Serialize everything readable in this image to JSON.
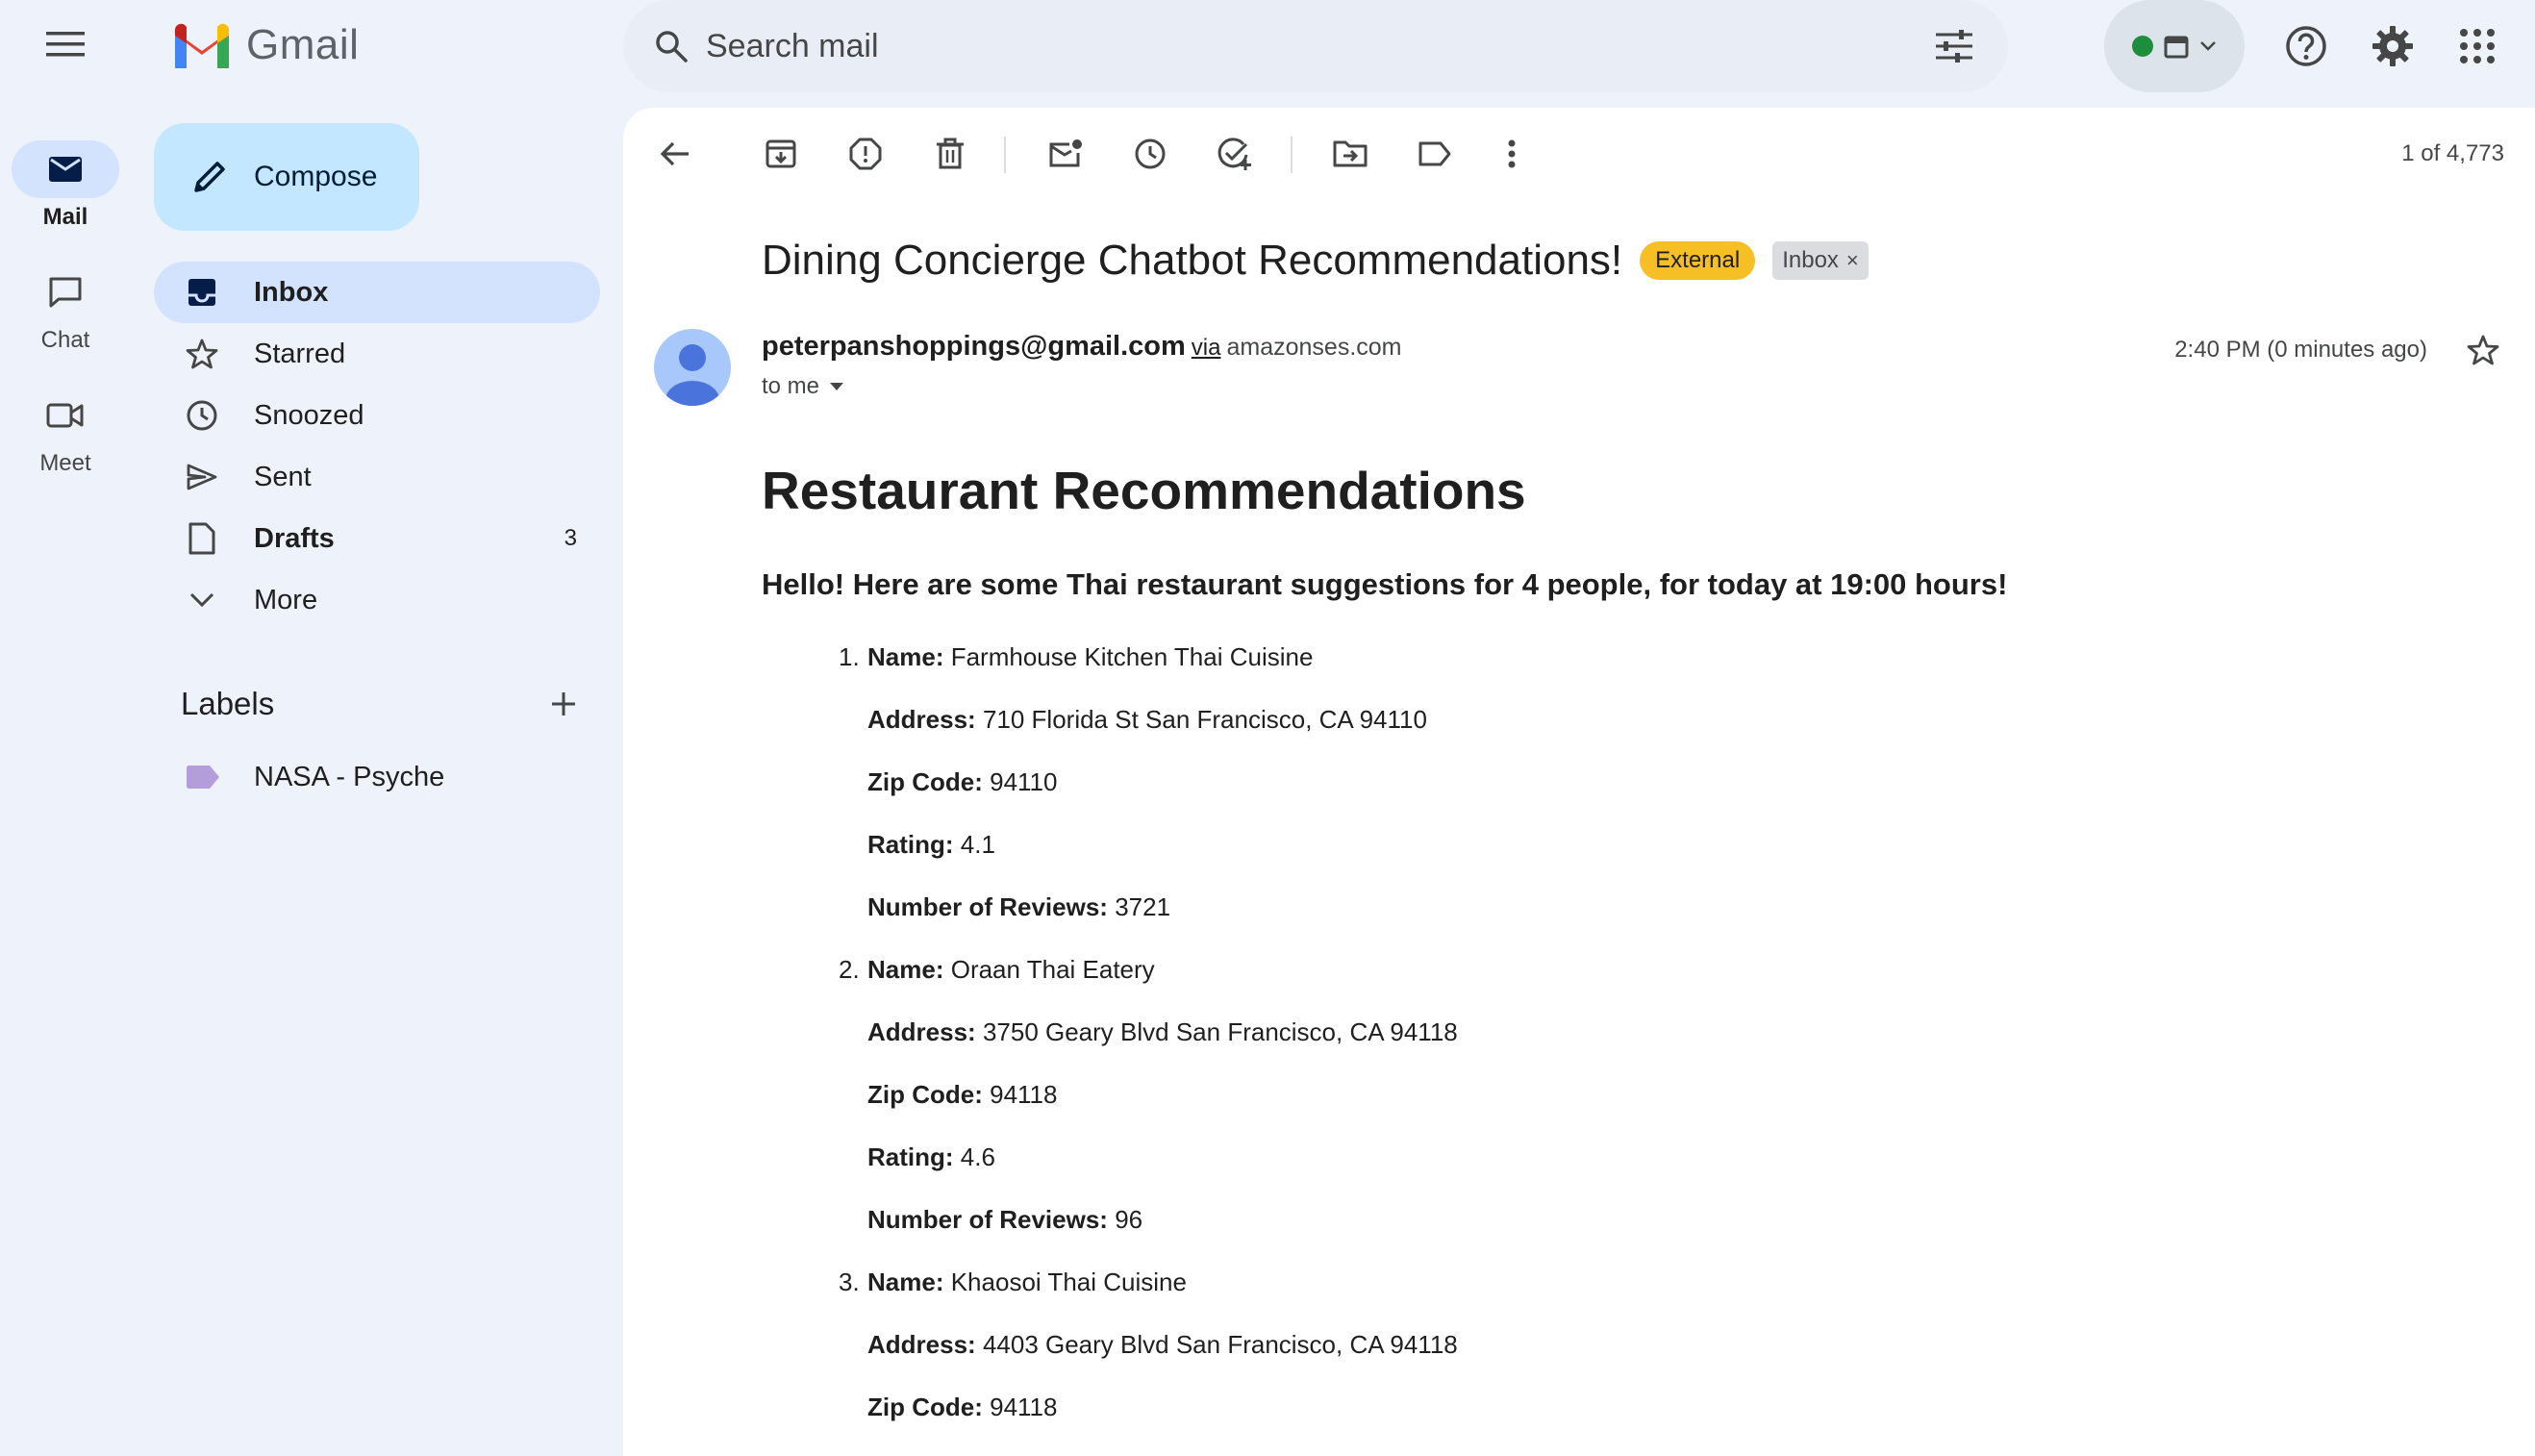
{
  "app": {
    "name": "Gmail"
  },
  "search": {
    "placeholder": "Search mail"
  },
  "rail": {
    "items": [
      {
        "label": "Mail",
        "icon": "mail-icon"
      },
      {
        "label": "Chat",
        "icon": "chat-icon"
      },
      {
        "label": "Meet",
        "icon": "meet-icon"
      }
    ]
  },
  "compose": {
    "label": "Compose"
  },
  "nav": {
    "items": [
      {
        "label": "Inbox",
        "icon": "inbox-icon",
        "count": ""
      },
      {
        "label": "Starred",
        "icon": "star-icon",
        "count": ""
      },
      {
        "label": "Snoozed",
        "icon": "clock-icon",
        "count": ""
      },
      {
        "label": "Sent",
        "icon": "send-icon",
        "count": ""
      },
      {
        "label": "Drafts",
        "icon": "draft-icon",
        "count": "3"
      },
      {
        "label": "More",
        "icon": "chevron-down-icon",
        "count": ""
      }
    ]
  },
  "labels": {
    "title": "Labels",
    "items": [
      {
        "label": "NASA - Psyche",
        "color": "#b39ddb"
      }
    ]
  },
  "toolbar": {
    "counter": "1 of 4,773"
  },
  "email": {
    "subject": "Dining Concierge Chatbot Recommendations!",
    "badges": {
      "external": "External",
      "inbox": "Inbox"
    },
    "from": "peterpanshoppings@gmail.com",
    "via": "via",
    "via_domain": "amazonses.com",
    "to": "to me",
    "time": "2:40 PM (0 minutes ago)",
    "heading": "Restaurant Recommendations",
    "greeting": "Hello! Here are some Thai restaurant suggestions for 4 people, for today at 19:00 hours!",
    "field_labels": {
      "name": "Name:",
      "address": "Address:",
      "zip": "Zip Code:",
      "rating": "Rating:",
      "reviews": "Number of Reviews:"
    },
    "restaurants": [
      {
        "num": "1.",
        "name": "Farmhouse Kitchen Thai Cuisine",
        "address": "710 Florida St San Francisco, CA 94110",
        "zip": "94110",
        "rating": "4.1",
        "reviews": "3721"
      },
      {
        "num": "2.",
        "name": "Oraan Thai Eatery",
        "address": "3750 Geary Blvd San Francisco, CA 94118",
        "zip": "94118",
        "rating": "4.6",
        "reviews": "96"
      },
      {
        "num": "3.",
        "name": "Khaosoi Thai Cuisine",
        "address": "4403 Geary Blvd San Francisco, CA 94118",
        "zip": "94118"
      }
    ]
  },
  "colors": {
    "accent": "#d3e3fd",
    "compose": "#c2e7ff",
    "external_badge": "#f6bf26",
    "status": "#1e8e3e"
  }
}
